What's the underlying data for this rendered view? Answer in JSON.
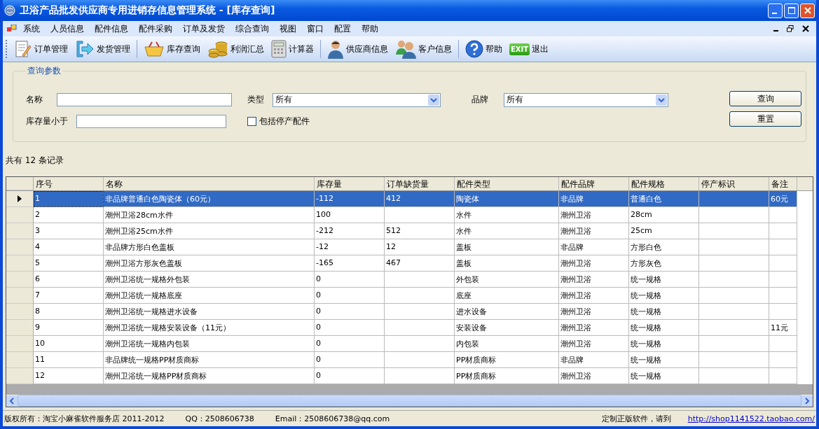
{
  "window": {
    "title": "卫浴产品批发供应商专用进销存信息管理系统 - [库存查询]"
  },
  "menu": [
    "系统",
    "人员信息",
    "配件信息",
    "配件采购",
    "订单及发货",
    "综合查询",
    "视图",
    "窗口",
    "配置",
    "帮助"
  ],
  "toolbar": [
    {
      "kind": "order",
      "label": "订单管理"
    },
    {
      "kind": "ship",
      "label": "发货管理"
    },
    {
      "kind": "sep"
    },
    {
      "kind": "basket",
      "label": "库存查询"
    },
    {
      "kind": "coins",
      "label": "利润汇总"
    },
    {
      "kind": "calc",
      "label": "计算器"
    },
    {
      "kind": "sep"
    },
    {
      "kind": "person",
      "label": "供应商信息"
    },
    {
      "kind": "people",
      "label": "客户信息"
    },
    {
      "kind": "sep"
    },
    {
      "kind": "help",
      "label": "帮助"
    },
    {
      "kind": "exit",
      "label": "退出",
      "badge": "EXIT"
    }
  ],
  "query": {
    "title": "查询参数",
    "name_label": "名称",
    "type_label": "类型",
    "type_value": "所有",
    "brand_label": "品牌",
    "brand_value": "所有",
    "stock_label": "库存量小于",
    "discontinued": {
      "label": "包括停产配件",
      "checked": false
    },
    "buttons": [
      "查询",
      "重置"
    ]
  },
  "count": "共有 12 条记录",
  "table": {
    "columns": [
      "序号",
      "名称",
      "库存量",
      "订单缺货量",
      "配件类型",
      "配件品牌",
      "配件规格",
      "停产标识",
      "备注"
    ],
    "rows": [
      {
        "selected": true,
        "cells": [
          "1",
          "非品牌普通白色陶瓷体（60元）",
          "-112",
          "412",
          "陶瓷体",
          "非品牌",
          "普通白色",
          "",
          "60元"
        ]
      },
      {
        "selected": false,
        "cells": [
          "2",
          "潮州卫浴28cm水件",
          "100",
          "",
          "水件",
          "潮州卫浴",
          "28cm",
          "",
          ""
        ]
      },
      {
        "selected": false,
        "cells": [
          "3",
          "潮州卫浴25cm水件",
          "-212",
          "512",
          "水件",
          "潮州卫浴",
          "25cm",
          "",
          ""
        ]
      },
      {
        "selected": false,
        "cells": [
          "4",
          "非品牌方形白色盖板",
          "-12",
          "12",
          "盖板",
          "非品牌",
          "方形白色",
          "",
          ""
        ]
      },
      {
        "selected": false,
        "cells": [
          "5",
          "潮州卫浴方形灰色盖板",
          "-165",
          "467",
          "盖板",
          "潮州卫浴",
          "方形灰色",
          "",
          ""
        ]
      },
      {
        "selected": false,
        "cells": [
          "6",
          "潮州卫浴统一规格外包装",
          "0",
          "",
          "外包装",
          "潮州卫浴",
          "统一规格",
          "",
          ""
        ]
      },
      {
        "selected": false,
        "cells": [
          "7",
          "潮州卫浴统一规格底座",
          "0",
          "",
          "底座",
          "潮州卫浴",
          "统一规格",
          "",
          ""
        ]
      },
      {
        "selected": false,
        "cells": [
          "8",
          "潮州卫浴统一规格进水设备",
          "0",
          "",
          "进水设备",
          "潮州卫浴",
          "统一规格",
          "",
          ""
        ]
      },
      {
        "selected": false,
        "cells": [
          "9",
          "潮州卫浴统一规格安装设备（11元）",
          "0",
          "",
          "安装设备",
          "潮州卫浴",
          "统一规格",
          "",
          "11元"
        ]
      },
      {
        "selected": false,
        "cells": [
          "10",
          "潮州卫浴统一规格内包装",
          "0",
          "",
          "内包装",
          "潮州卫浴",
          "统一规格",
          "",
          ""
        ]
      },
      {
        "selected": false,
        "cells": [
          "11",
          "非品牌统一规格PP材质商标",
          "0",
          "",
          "PP材质商标",
          "非品牌",
          "统一规格",
          "",
          ""
        ]
      },
      {
        "selected": false,
        "cells": [
          "12",
          "潮州卫浴统一规格PP材质商标",
          "0",
          "",
          "PP材质商标",
          "潮州卫浴",
          "统一规格",
          "",
          ""
        ]
      }
    ]
  },
  "status_bar": {
    "copyright": "版权所有：淘宝小麻雀软件服务店 2011-2012",
    "qq": "QQ：2508606738",
    "email": "Email：2508606738@qq.com",
    "promo": "定制正版软件，请到",
    "link": "http://shop1141522.taobao.com/"
  }
}
